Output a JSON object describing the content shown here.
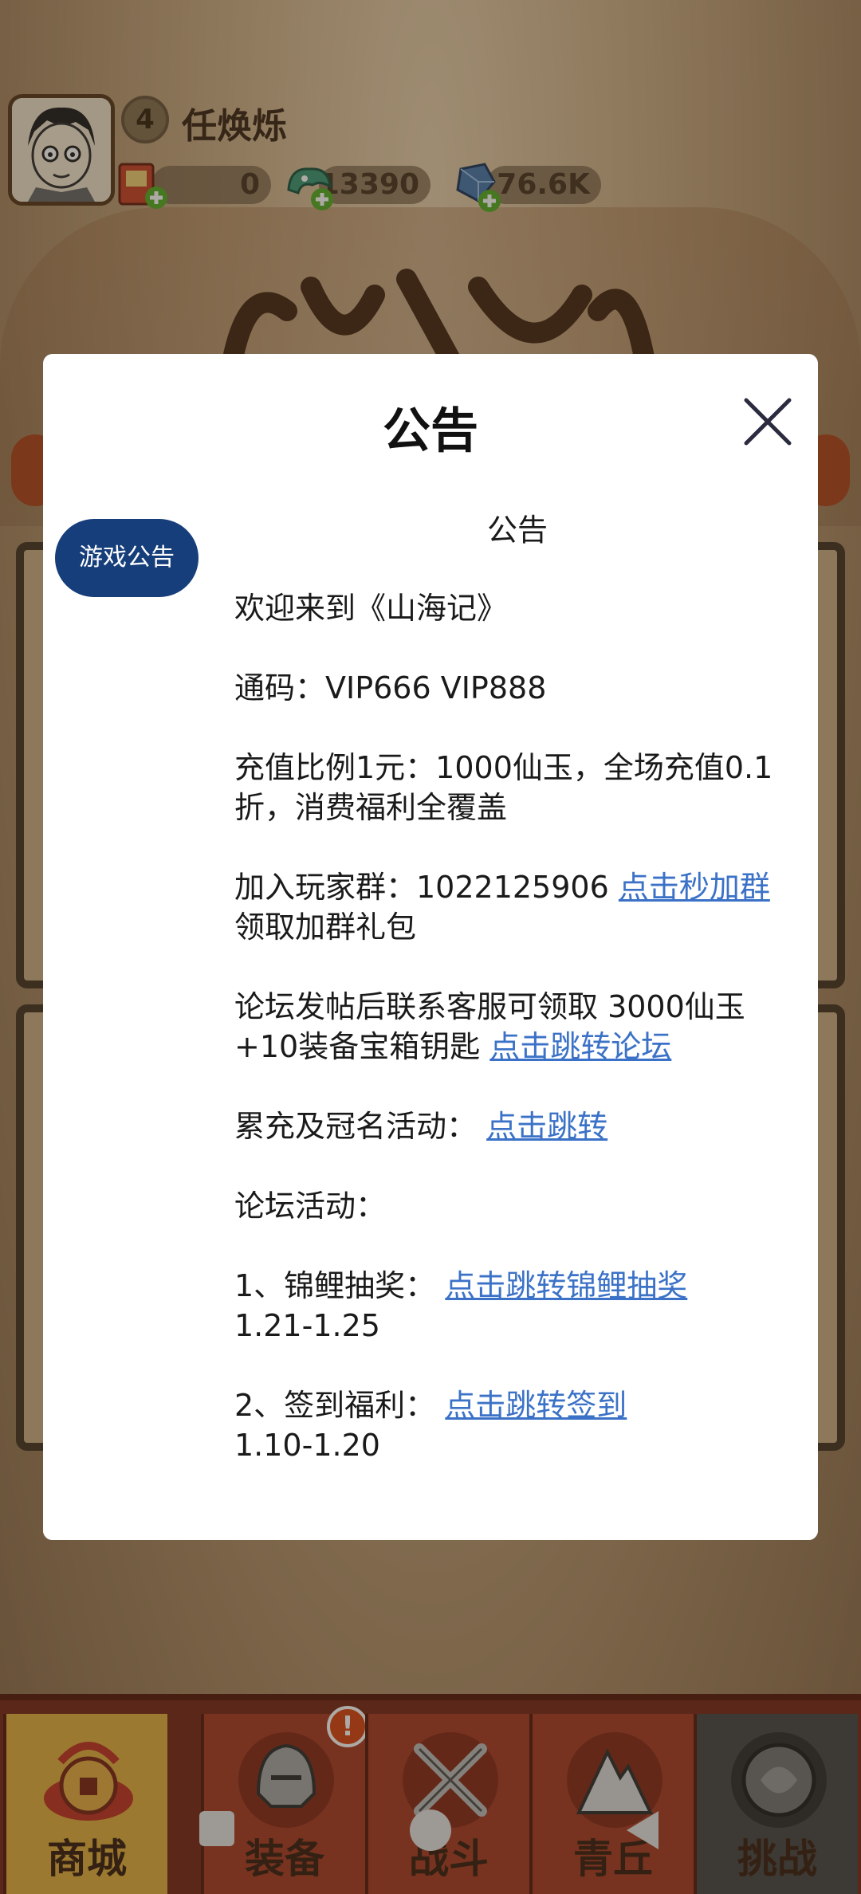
{
  "hud": {
    "level": "4",
    "player_name": "任焕烁",
    "resources": [
      "0",
      "13390",
      "76.6K"
    ]
  },
  "modal": {
    "title": "公告",
    "side_tab": "游戏公告",
    "content_title": "公告",
    "welcome": "欢迎来到《山海记》",
    "code_line": "通码：VIP666 VIP888",
    "recharge_line": "充值比例1元：1000仙玉，全场充值0.1折，消费福利全覆盖",
    "group_prefix": "加入玩家群：1022125906 ",
    "group_link": "点击秒加群",
    "group_suffix": " 领取加群礼包",
    "forum_prefix": "论坛发帖后联系客服可领取 3000仙玉+10装备宝箱钥匙 ",
    "forum_link": "点击跳转论坛",
    "activity_prefix": "累充及冠名活动：",
    "activity_link": "点击跳转",
    "forum_activity": "论坛活动：",
    "item1_prefix": "1、锦鲤抽奖：",
    "item1_link": "点击跳转锦鲤抽奖",
    "item1_date": "1.21-1.25",
    "item2_prefix": "2、签到福利：",
    "item2_link": "点击跳转签到",
    "item2_date": "1.10-1.20"
  },
  "nav": {
    "tabs": [
      "商城",
      "装备",
      "战斗",
      "青丘",
      "挑战"
    ],
    "active": "商城",
    "badge": "!"
  },
  "colors": {
    "side_tab": "#163e7a",
    "link": "#3b72c7"
  }
}
